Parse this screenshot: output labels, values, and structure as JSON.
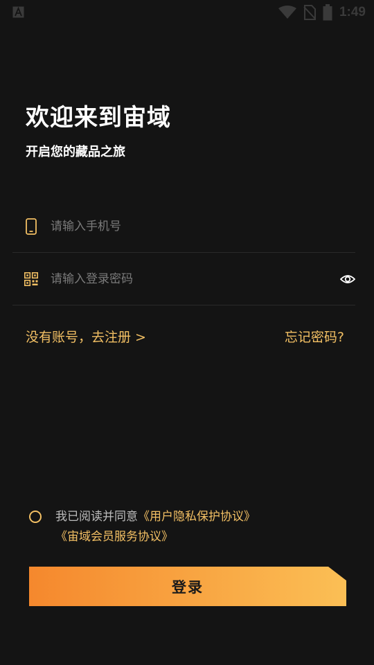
{
  "status_bar": {
    "time": "1:49",
    "left_icon": "a-icon",
    "icons": [
      "wifi-icon",
      "no-sim-icon",
      "battery-icon"
    ]
  },
  "header": {
    "title": "欢迎来到宙域",
    "subtitle": "开启您的藏品之旅"
  },
  "form": {
    "phone": {
      "placeholder": "请输入手机号",
      "value": "",
      "icon": "phone-icon"
    },
    "password": {
      "placeholder": "请输入登录密码",
      "value": "",
      "icon": "qr-code-icon",
      "toggle_icon": "eye-icon"
    }
  },
  "links": {
    "register": "没有账号，去注册 >",
    "forgot": "忘记密码?"
  },
  "agreement": {
    "checked": false,
    "prefix": "我已阅读并同意",
    "privacy_link": "《用户隐私保护协议》",
    "member_link": "《宙域会员服务协议》"
  },
  "login_button": {
    "label": "登录"
  },
  "colors": {
    "background": "#141414",
    "accent": "#f3c064",
    "button_start": "#f5882d",
    "button_end": "#fbbf55",
    "placeholder": "#7a7a7a"
  }
}
